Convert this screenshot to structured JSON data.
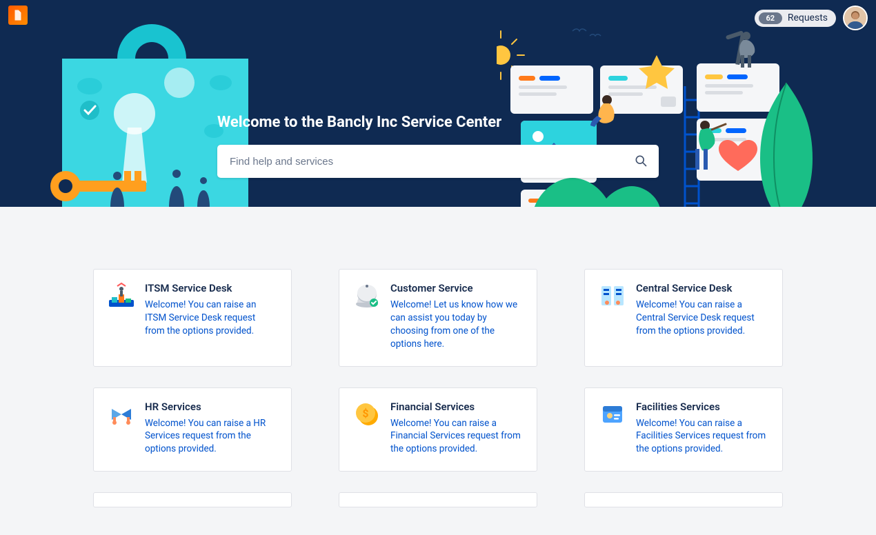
{
  "header": {
    "requests_count": "62",
    "requests_label": "Requests"
  },
  "hero": {
    "title": "Welcome to the Bancly Inc Service Center",
    "search_placeholder": "Find help and services"
  },
  "portals": [
    {
      "icon": "itsm",
      "title": "ITSM Service Desk",
      "desc": "Welcome! You can raise an ITSM Service Desk request from the options provided."
    },
    {
      "icon": "customer",
      "title": "Customer Service",
      "desc": "Welcome! Let us know how we can assist you today by choosing from one of the options here."
    },
    {
      "icon": "central",
      "title": "Central Service Desk",
      "desc": "Welcome! You can raise a Central Service Desk request from the options provided."
    },
    {
      "icon": "hr",
      "title": "HR Services",
      "desc": "Welcome! You can raise a HR Services request from the options provided."
    },
    {
      "icon": "financial",
      "title": "Financial Services",
      "desc": "Welcome! You can raise a Financial Services request from the options provided."
    },
    {
      "icon": "facilities",
      "title": "Facilities Services",
      "desc": "Welcome! You can raise a Facilities Services request from the options provided."
    }
  ]
}
